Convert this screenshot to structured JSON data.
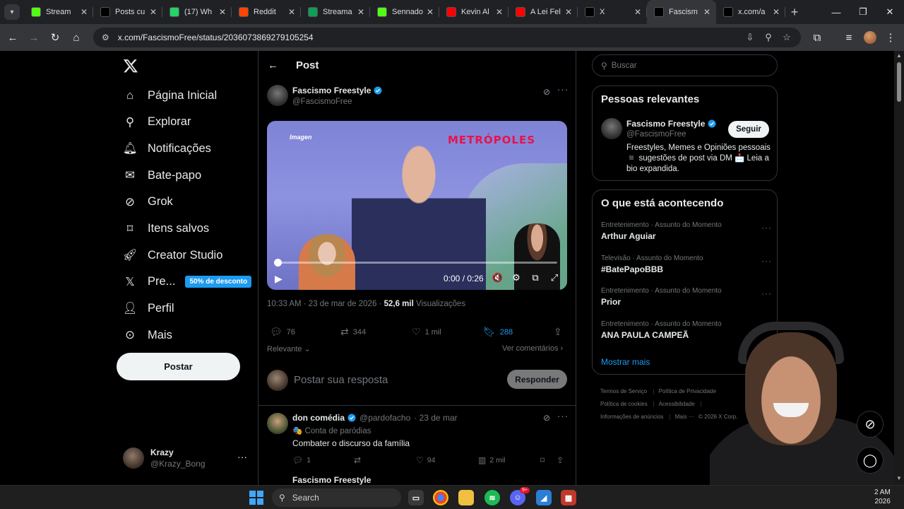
{
  "browser": {
    "tabs": [
      {
        "label": "Stream",
        "favicon": "kick-icon",
        "color": "#53fc18"
      },
      {
        "label": "Posts cu",
        "favicon": "x-icon",
        "color": "#000000"
      },
      {
        "label": "(17) Wh",
        "favicon": "whatsapp-icon",
        "color": "#25d366"
      },
      {
        "label": "Reddit",
        "favicon": "reddit-icon",
        "color": "#ff4500"
      },
      {
        "label": "Streama",
        "favicon": "streamelements-icon",
        "color": "#0f9d58"
      },
      {
        "label": "Sennado",
        "favicon": "kick-icon",
        "color": "#53fc18"
      },
      {
        "label": "Kevin Al",
        "favicon": "youtube-icon",
        "color": "#ff0000"
      },
      {
        "label": "A Lei Fel",
        "favicon": "youtube-icon",
        "color": "#ff0000"
      },
      {
        "label": "X",
        "favicon": "x-icon",
        "color": "#000000"
      },
      {
        "label": "Fascism",
        "favicon": "x-icon",
        "color": "#000000",
        "active": true
      },
      {
        "label": "x.com/a",
        "favicon": "x-icon",
        "color": "#000000"
      }
    ],
    "url": "x.com/FascismoFree/status/2036073869279105254"
  },
  "nav": {
    "items": [
      {
        "label": "Página Inicial",
        "icon": "home-icon"
      },
      {
        "label": "Explorar",
        "icon": "search-icon"
      },
      {
        "label": "Notificações",
        "icon": "bell-icon"
      },
      {
        "label": "Bate-papo",
        "icon": "mail-icon"
      },
      {
        "label": "Grok",
        "icon": "grok-icon"
      },
      {
        "label": "Itens salvos",
        "icon": "bookmark-icon"
      },
      {
        "label": "Creator Studio",
        "icon": "rocket-icon"
      },
      {
        "label": "Pre...",
        "icon": "x-premium-icon",
        "badge": "50% de desconto"
      },
      {
        "label": "Perfil",
        "icon": "person-icon"
      },
      {
        "label": "Mais",
        "icon": "more-circle-icon"
      }
    ],
    "post_button": "Postar",
    "account": {
      "name": "Krazy",
      "handle": "@Krazy_Bong"
    }
  },
  "post": {
    "header_title": "Post",
    "author_name": "Fascismo Freestyle",
    "author_handle": "@FascismoFree",
    "video": {
      "label": "Imagen",
      "logo": "METRÓPOLES",
      "time": "0:00 / 0:26",
      "progress": 0
    },
    "timestamp": "10:33 AM · 23 de mar de 2026 · ",
    "views_count": "52,6 mil",
    "views_label": " Visualizações",
    "stats": {
      "replies": "76",
      "reposts": "344",
      "likes": "1 mil",
      "bookmarks": "288"
    },
    "sort_label": "Relevante",
    "see_comments": "Ver comentários",
    "reply_placeholder": "Postar sua resposta",
    "reply_button": "Responder"
  },
  "reply": {
    "name": "don comédia",
    "handle": "@pardofacho",
    "date": "· 23 de mar",
    "label": "🎭 Conta de paródias",
    "text": "Combater o discurso da família",
    "stats": {
      "replies": "1",
      "likes": "94",
      "views": "2 mil"
    },
    "next_peek": "Fascismo Freestyle"
  },
  "sidebar": {
    "search_placeholder": "Buscar",
    "relevant_title": "Pessoas relevantes",
    "person": {
      "name": "Fascismo Freestyle",
      "handle": "@FascismoFree",
      "follow": "Seguir",
      "bio": "Freestyles, Memes e Opiniões pessoais ◾ sugestões de post via DM 📩 Leia a bio expandida."
    },
    "trends_title": "O que está acontecendo",
    "trends": [
      {
        "category": "Entretenimento · Assunto do Momento",
        "name": "Arthur Aguiar"
      },
      {
        "category": "Televisão · Assunto do Momento",
        "name": "#BatePapoBBB"
      },
      {
        "category": "Entretenimento · Assunto do Momento",
        "name": "Prior"
      },
      {
        "category": "Entretenimento · Assunto do Momento",
        "name": "ANA PAULA CAMPEÃ"
      }
    ],
    "show_more": "Mostrar mais",
    "footer": [
      "Termos de Serviço",
      "Política de Privacidade",
      "Política de cookies",
      "Acessibilidade",
      "Informações de anúncios",
      "Mais ···",
      "© 2026 X Corp."
    ]
  },
  "taskbar": {
    "search": "Search",
    "clock_time": "2 AM",
    "clock_year": "2026",
    "discord_badge": "9+"
  },
  "colors": {
    "accent": "#1d9bf0",
    "background": "#000000",
    "border": "#2f3336",
    "muted": "#71767b"
  }
}
